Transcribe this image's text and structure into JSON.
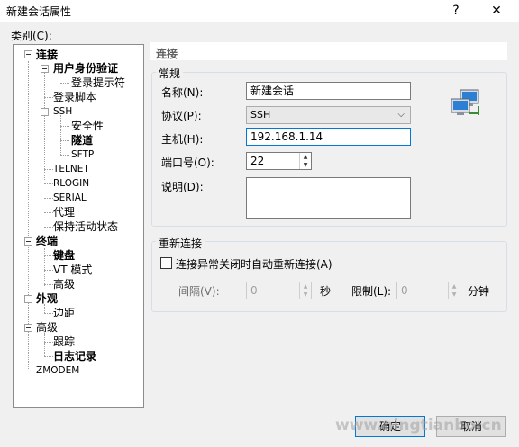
{
  "window": {
    "title": "新建会话属性",
    "help_glyph": "?",
    "close_glyph": "✕"
  },
  "category_label": "类别(C):",
  "tree": {
    "connection": "连接",
    "user_auth": "用户身份验证",
    "login_prompts": "登录提示符",
    "login_script": "登录脚本",
    "ssh": "SSH",
    "security": "安全性",
    "tunnel": "隧道",
    "sftp": "SFTP",
    "telnet": "TELNET",
    "rlogin": "RLOGIN",
    "serial": "SERIAL",
    "proxy": "代理",
    "keepalive": "保持活动状态",
    "terminal": "终端",
    "keyboard": "键盘",
    "vt_mode": "VT 模式",
    "advanced_term": "高级",
    "appearance": "外观",
    "margin": "边距",
    "advanced": "高级",
    "trace": "跟踪",
    "logging": "日志记录",
    "zmodem": "ZMODEM"
  },
  "section_title": "连接",
  "general": {
    "group_label": "常规",
    "name_label": "名称(N):",
    "name_value": "新建会话",
    "protocol_label": "协议(P):",
    "protocol_value": "SSH",
    "host_label": "主机(H):",
    "host_value": "192.168.1.14",
    "port_label": "端口号(O):",
    "port_value": "22",
    "desc_label": "说明(D):",
    "desc_value": ""
  },
  "reconnect": {
    "group_label": "重新连接",
    "checkbox_label": "连接异常关闭时自动重新连接(A)",
    "checked": false,
    "interval_label": "间隔(V):",
    "interval_value": "0",
    "interval_unit": "秒",
    "limit_label": "限制(L):",
    "limit_value": "0",
    "limit_unit": "分钟"
  },
  "buttons": {
    "ok": "确定",
    "cancel": "取消"
  },
  "watermark": "www.ningtianbo.cn",
  "icons": {
    "expander": "minus-box",
    "network": "network-computers-icon",
    "combo_arrow": "⌵",
    "spin_up": "▲",
    "spin_down": "▼"
  }
}
